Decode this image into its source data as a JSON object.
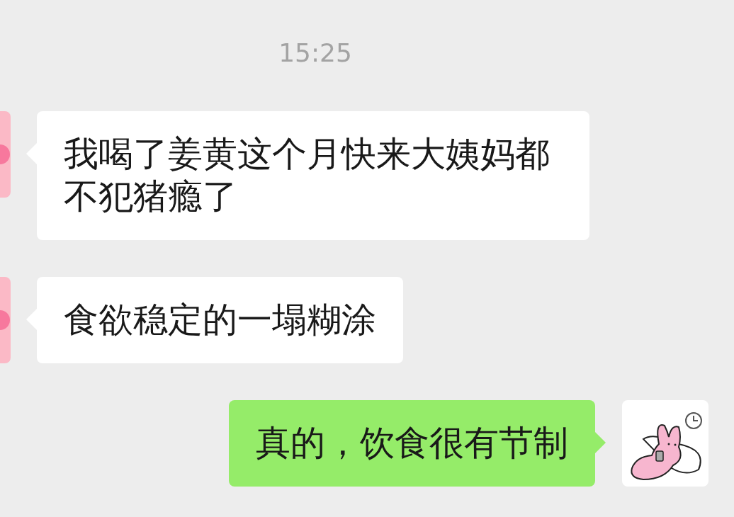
{
  "time": "15:25",
  "messages": [
    {
      "kind": "received",
      "text": "我喝了姜黄这个月快来大姨妈都不犯猪瘾了"
    },
    {
      "kind": "received",
      "text": "食欲稳定的一塌糊涂"
    },
    {
      "kind": "sent",
      "text": "真的，饮食很有节制"
    }
  ]
}
